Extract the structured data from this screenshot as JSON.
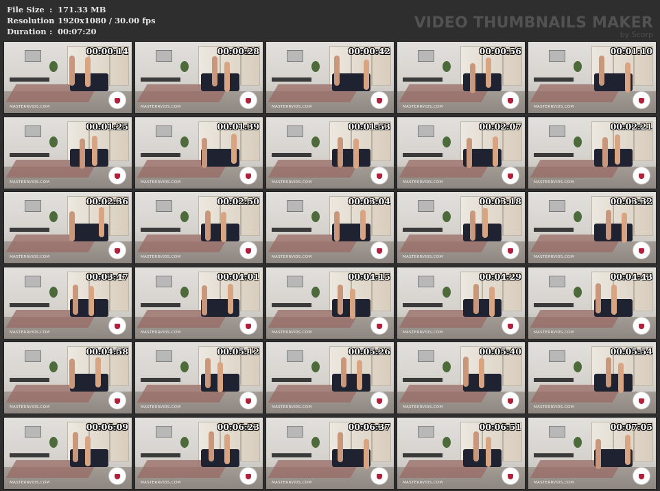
{
  "header": {
    "file_size_label": "File Size",
    "file_size_value": "171.33 MB",
    "resolution_label": "Resolution",
    "resolution_value": "1920x1080 / 30.00 fps",
    "duration_label": "Duration",
    "duration_value": "00:07:20",
    "separator": ":"
  },
  "brand": {
    "title": "VIDEO THUMBNAILS MAKER",
    "byline": "by Scorp"
  },
  "thumbnails": [
    {
      "time": "00:00:14"
    },
    {
      "time": "00:00:28"
    },
    {
      "time": "00:00:42"
    },
    {
      "time": "00:00:56"
    },
    {
      "time": "00:01:10"
    },
    {
      "time": "00:01:25"
    },
    {
      "time": "00:01:39"
    },
    {
      "time": "00:01:53"
    },
    {
      "time": "00:02:07"
    },
    {
      "time": "00:02:21"
    },
    {
      "time": "00:02:36"
    },
    {
      "time": "00:02:50"
    },
    {
      "time": "00:03:04"
    },
    {
      "time": "00:03:18"
    },
    {
      "time": "00:03:32"
    },
    {
      "time": "00:03:47"
    },
    {
      "time": "00:04:01"
    },
    {
      "time": "00:04:15"
    },
    {
      "time": "00:04:29"
    },
    {
      "time": "00:04:43"
    },
    {
      "time": "00:04:58"
    },
    {
      "time": "00:05:12"
    },
    {
      "time": "00:05:26"
    },
    {
      "time": "00:05:40"
    },
    {
      "time": "00:05:54"
    },
    {
      "time": "00:06:09"
    },
    {
      "time": "00:06:23"
    },
    {
      "time": "00:06:37"
    },
    {
      "time": "00:06:51"
    },
    {
      "time": "00:07:05"
    }
  ],
  "watermark_text": "MASTERRVIDS.COM"
}
